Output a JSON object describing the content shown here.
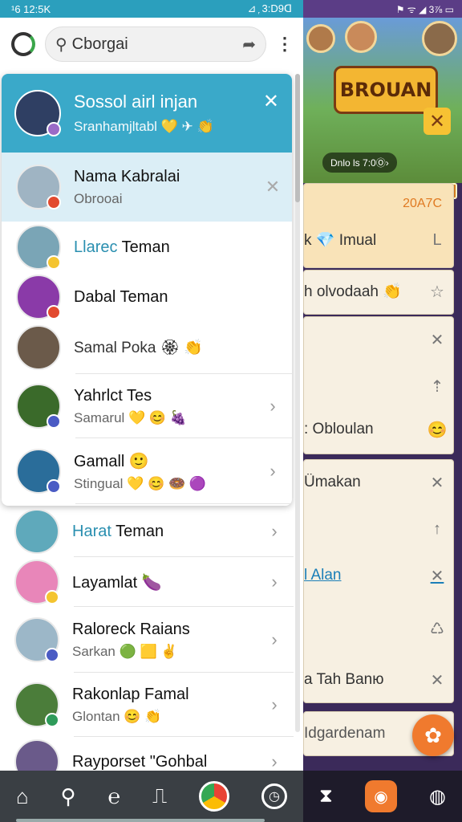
{
  "status_bar": {
    "left_text": "¹6 12:5K",
    "right_text": "⊿ ᷊ 3:D9ᗡ"
  },
  "search": {
    "value": "Cborgai"
  },
  "panel": {
    "title": "Sossol airl injan",
    "subtitle": "Sranhamjltabl 💛 ✈ 👏"
  },
  "contacts_top": [
    {
      "name_accent": "",
      "name": "Nama Kabralai",
      "sub": "Obrooai",
      "selected": true,
      "action": "close",
      "avatar_color": "#9fb4c3",
      "badge_color": "#e24a2f"
    },
    {
      "name_accent": "Llarec",
      "name": " Teman",
      "sub": "",
      "selected": false,
      "action": "",
      "avatar_color": "#7aa5b6",
      "badge_color": "#f4c430"
    },
    {
      "name_accent": "",
      "name": "Dabal Teman",
      "sub": "",
      "selected": false,
      "action": "",
      "avatar_color": "#8a3aa8",
      "badge_color": "#e24a2f"
    },
    {
      "name_accent": "",
      "name": "",
      "sub": "Samal Poka 🏵 👏",
      "selected": false,
      "action": "",
      "avatar_color": "#6b5a4a",
      "badge_color": ""
    },
    {
      "name_accent": "",
      "name": "Yahrlct Tes",
      "sub": "Samarul 💛 😊 🍇",
      "selected": false,
      "action": "chevron",
      "avatar_color": "#3a6a2a",
      "badge_color": "#4a5bc4"
    },
    {
      "name_accent": "",
      "name": "Gamall 🙂",
      "sub": "Stingual 💛 😊 🍩 🟣",
      "selected": false,
      "action": "chevron",
      "avatar_color": "#2a6d9a",
      "badge_color": "#4a5bc4"
    }
  ],
  "contacts_bottom": [
    {
      "name_accent": "Harat",
      "name": " Teman",
      "sub": "",
      "action": "chevron",
      "avatar_color": "#5fa9bb",
      "badge_color": ""
    },
    {
      "name_accent": "",
      "name": "Layamlat 🍆",
      "sub": "",
      "action": "chevron",
      "avatar_color": "#e886b9",
      "badge_color": "#f4c430"
    },
    {
      "name_accent": "",
      "name": "Ralorеck Raians",
      "sub": "Sarkan 🟢 🟨 ✌",
      "action": "chevron",
      "avatar_color": "#9cb7c8",
      "badge_color": "#4a5bc4"
    },
    {
      "name_accent": "",
      "name": "Rakonlap Famal",
      "sub": "Glontan 😊 👏",
      "action": "chevron",
      "avatar_color": "#4b7d3a",
      "badge_color": "#2e9b5a"
    },
    {
      "name_accent": "",
      "name": "Rayporset \"Gohbal",
      "sub": "",
      "action": "chevron",
      "avatar_color": "#6a5a8a",
      "badge_color": ""
    }
  ],
  "bottom_nav": {
    "items": [
      "home-icon",
      "search-icon",
      "ear-icon",
      "document-icon",
      "browser-icon",
      "clock-icon"
    ]
  },
  "game": {
    "status_text": "⚑ ᯤ ◢ 3⅞ ▭",
    "title": "BROUAN",
    "chip": "Dnlo ls 7:0Ⓞ›",
    "card1": {
      "badge": "20A7C",
      "row1": "k 💎 Imual",
      "row1_icon": "L",
      "row2": "h olvodaah 👏",
      "row2_icon": "☆"
    },
    "card2": {
      "row1_icon": "✕",
      "row2_icon": "⇡",
      "row3": ": Obloulan",
      "row3_icon": "😊"
    },
    "card3": {
      "row1": "Ümakan",
      "row1_icon": "✕",
      "row2_icon": "↑",
      "row3": "l Alan",
      "row3_icon": "✕",
      "row4_icon": "♺",
      "row5": "a Tah Banю",
      "row5_icon": "✕"
    },
    "card4": {
      "row1": "Idgardenam"
    },
    "nav_items": [
      "hourglass-icon",
      "camera-icon",
      "chat-icon"
    ]
  },
  "colors": {
    "accent": "#3aa9c9",
    "selected_row": "#dbeef6",
    "nav_bg": "#3a3f44"
  }
}
